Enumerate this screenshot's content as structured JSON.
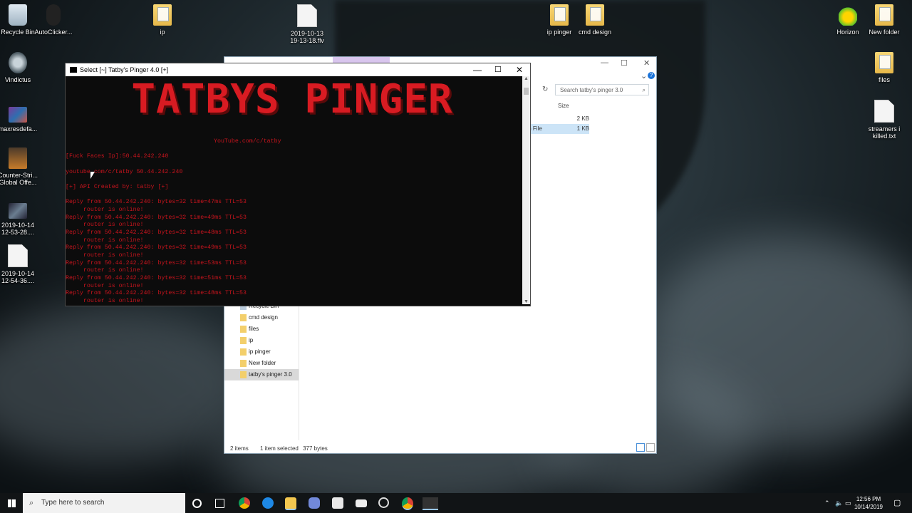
{
  "desktop": {
    "icons": {
      "recycle_bin": "Recycle Bin",
      "autoclicker": "AutoClicker...",
      "ip": "ip",
      "flv_file": "2019-10-13\n19-13-18.flv",
      "ip_pinger": "ip pinger",
      "cmd_design": "cmd  design",
      "horizon": "Horizon",
      "new_folder": "New folder",
      "vindictus": "Vindictus",
      "files": "files",
      "maxresdefault": "maxresdefa...",
      "streamers_killed": "streamers i\nkilled.txt",
      "counter_strike": "Counter-Stri...\nGlobal Offe...",
      "video1": "2019-10-14\n12-53-28....",
      "video2": "2019-10-14\n12-54-36...."
    }
  },
  "explorer": {
    "search_placeholder": "Search tatby's pinger 3.0",
    "size_header": "Size",
    "rows": [
      {
        "name": "",
        "size": "2 KB"
      },
      {
        "name": "tch File",
        "size": "1 KB"
      }
    ],
    "nav": [
      "Recycle Bin",
      "cmd  design",
      "files",
      "ip",
      "ip pinger",
      "New folder",
      "tatby's pinger 3.0"
    ],
    "status": {
      "items": "2 items",
      "selected": "1 item selected",
      "bytes": "377 bytes"
    }
  },
  "cmd": {
    "title": "Select [~] Tatby's Pinger 4.0 [+]",
    "banner": "TATBYS PINGER",
    "lines": {
      "channel": "YouTube.com/c/tatby",
      "prompt": "[Fuck Faces Ip]:50.44.242.240",
      "target": "youtube.com/c/tatby 50.44.242.240",
      "api": "[+] API Created by: tatby [+]",
      "reply1": "Reply from 50.44.242.240: bytes=32 time=47ms TTL=53",
      "reply2": "Reply from 50.44.242.240: bytes=32 time=49ms TTL=53",
      "reply3": "Reply from 50.44.242.240: bytes=32 time=48ms TTL=53",
      "reply4": "Reply from 50.44.242.240: bytes=32 time=49ms TTL=53",
      "reply5": "Reply from 50.44.242.240: bytes=32 time=53ms TTL=53",
      "reply6": "Reply from 50.44.242.240: bytes=32 time=51ms TTL=53",
      "reply7": "Reply from 50.44.242.240: bytes=32 time=48ms TTL=53",
      "online": "     router is online!"
    }
  },
  "taskbar": {
    "search_placeholder": "Type here to search",
    "time": "12:56 PM",
    "date": "10/14/2019"
  }
}
